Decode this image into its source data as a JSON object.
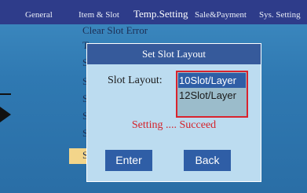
{
  "tabs": [
    {
      "label": "General"
    },
    {
      "label": "Item & Slot"
    },
    {
      "label": "Temp.Setting"
    },
    {
      "label": "Sale&Payment"
    },
    {
      "label": "Sys. Setting"
    }
  ],
  "background_menu": {
    "items": [
      "Clear Slot Error",
      "T",
      "S",
      "S",
      "S",
      "S",
      "S",
      "S"
    ]
  },
  "dialog": {
    "title": "Set Slot Layout",
    "field_label": "Slot Layout:",
    "options": [
      "10Slot/Layer",
      "12Slot/Layer"
    ],
    "selected_index": 0,
    "status": "Setting .... Succeed",
    "enter_label": "Enter",
    "back_label": "Back"
  },
  "colors": {
    "tabbar": "#2e3c8a",
    "dialog_bg": "#bcdcf0",
    "accent_blue": "#2f5ea6",
    "status_red": "#d4232b"
  }
}
